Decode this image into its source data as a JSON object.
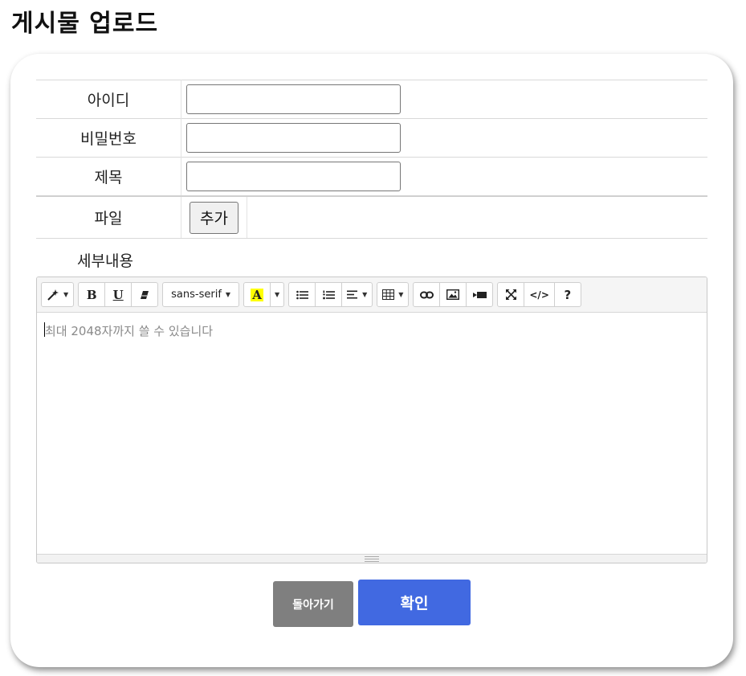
{
  "page": {
    "title": "게시물 업로드"
  },
  "form": {
    "id_label": "아이디",
    "password_label": "비밀번호",
    "subject_label": "제목",
    "file_label": "파일",
    "add_button_label": "추가",
    "detail_label": "세부내용"
  },
  "editor": {
    "font_name": "sans-serif",
    "placeholder": "최대 2048자까지 쓸 수 있습니다",
    "toolbar_icons": [
      "magic-icon",
      "bold-icon",
      "underline-icon",
      "eraser-icon",
      "font-color-icon",
      "unordered-list-icon",
      "ordered-list-icon",
      "align-icon",
      "table-icon",
      "link-icon",
      "picture-icon",
      "video-icon",
      "fullscreen-icon",
      "code-view-icon",
      "help-icon"
    ],
    "bold_glyph": "B",
    "underline_glyph": "U",
    "help_glyph": "?",
    "font_color_glyph": "A",
    "code_glyph": "</>"
  },
  "actions": {
    "back_label": "돌아가기",
    "confirm_label": "확인"
  },
  "colors": {
    "confirm": "#4169e1",
    "back": "#7f7f7f",
    "highlight": "#ffff00"
  }
}
